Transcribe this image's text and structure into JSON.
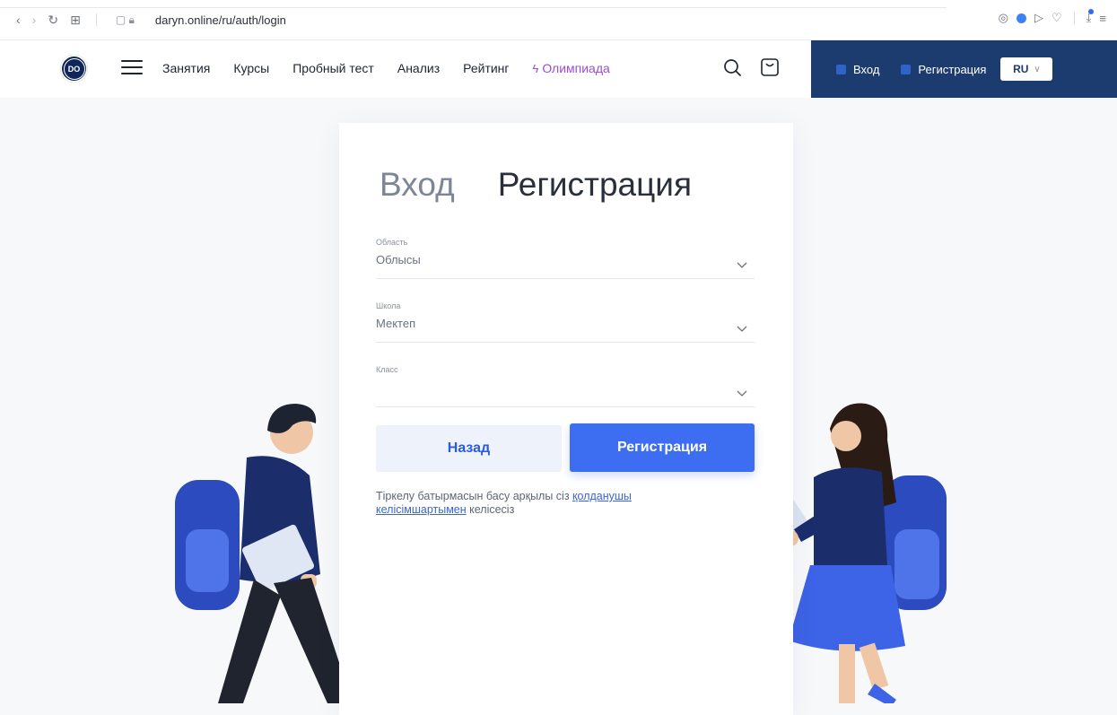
{
  "browser": {
    "url": "daryn.online/ru/auth/login"
  },
  "header": {
    "logo_text": "DO",
    "nav": [
      "Занятия",
      "Курсы",
      "Пробный тест",
      "Анализ",
      "Рейтинг",
      "Олимпиада"
    ],
    "olympiad_icon": "⚡",
    "login": "Вход",
    "register": "Регистрация",
    "lang": "RU"
  },
  "form": {
    "tab_login": "Вход",
    "tab_register": "Регистрация",
    "fields": [
      {
        "label": "Область",
        "value": "Облысы"
      },
      {
        "label": "Школа",
        "value": "Мектеп"
      },
      {
        "label": "Класс",
        "value": ""
      }
    ],
    "back_button": "Назад",
    "register_button": "Регистрация",
    "agreement_prefix": "Тіркелу батырмасын басу арқылы сіз",
    "agreement_link": "қолданушы келісімшартымен",
    "agreement_suffix": "келісесіз"
  },
  "colors": {
    "primary": "#3d6df0",
    "header_panel": "#1c3b6e",
    "olympiad": "#9b4dd1"
  }
}
